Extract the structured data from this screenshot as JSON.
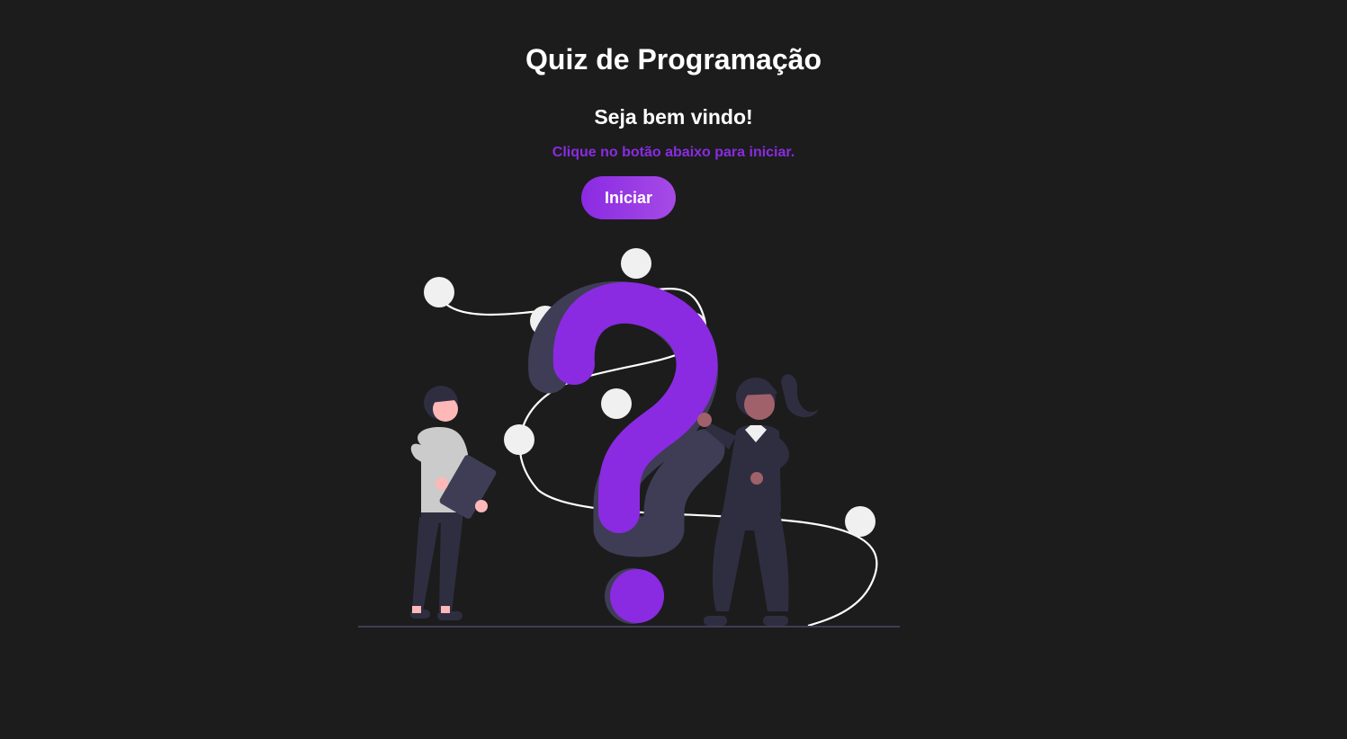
{
  "header": {
    "title": "Quiz de Programação"
  },
  "intro": {
    "welcome": "Seja bem vindo!",
    "hint": "Clique no botão abaixo para iniciar.",
    "start_label": "Iniciar"
  },
  "colors": {
    "background": "#1c1c1c",
    "accent": "#8a2be2",
    "accent_light": "#a64ae6",
    "text": "#ffffff"
  },
  "illustration": {
    "icon": "question-mark-people-illustration"
  }
}
